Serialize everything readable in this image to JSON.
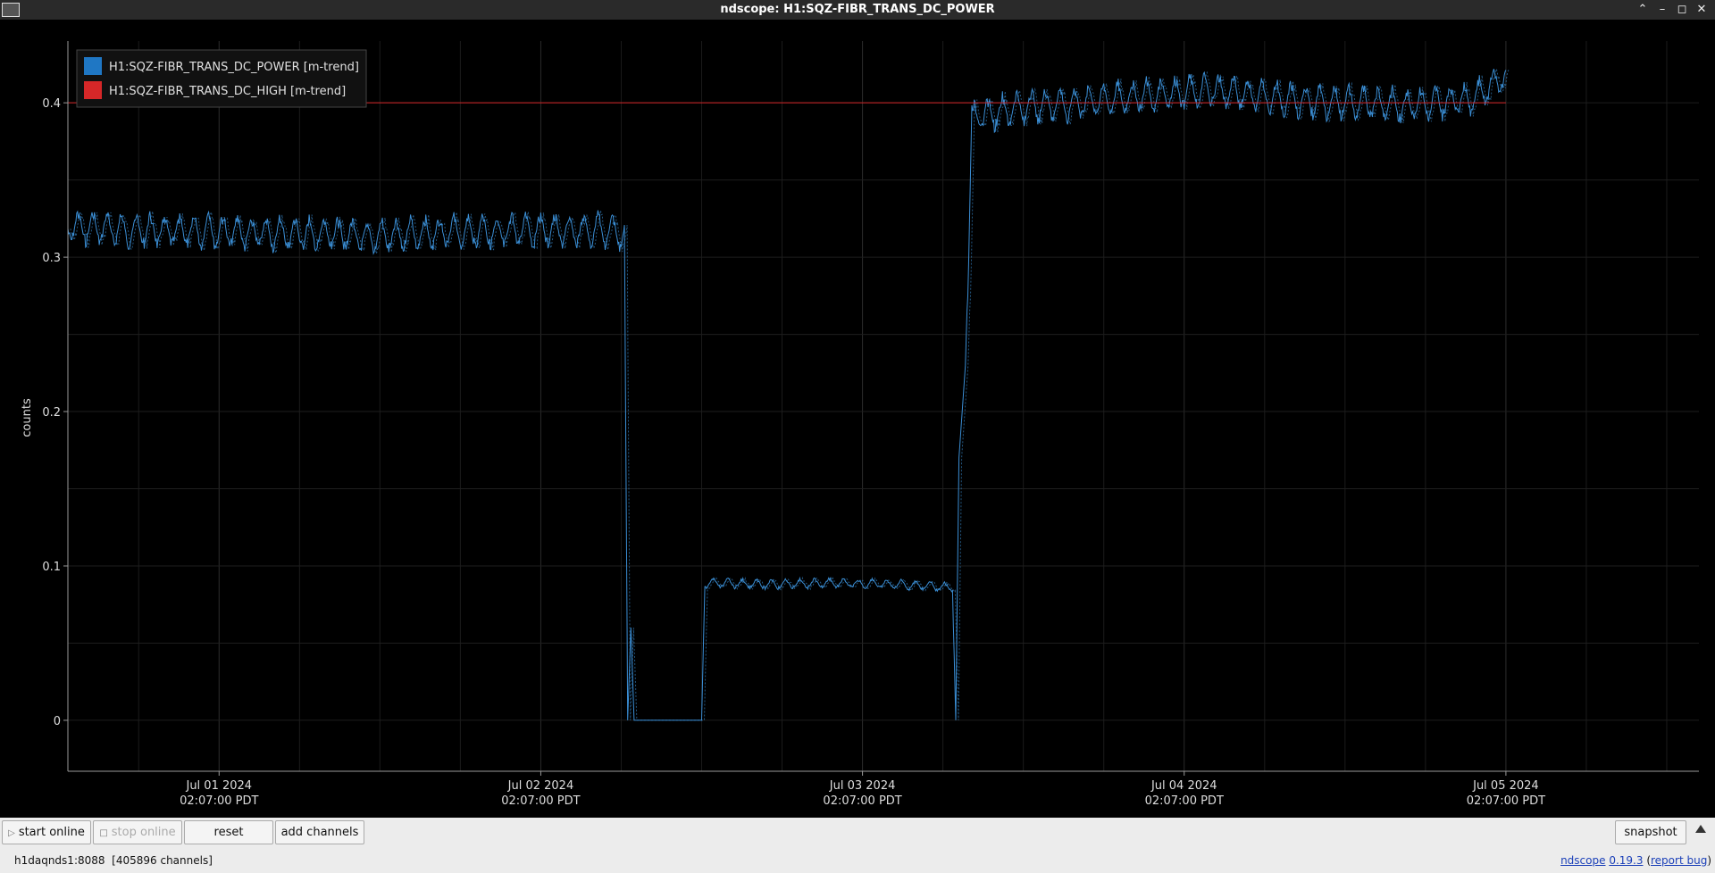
{
  "window": {
    "title": "ndscope: H1:SQZ-FIBR_TRANS_DC_POWER"
  },
  "legend": [
    {
      "label": "H1:SQZ-FIBR_TRANS_DC_POWER [m-trend]",
      "color": "#1f77c4"
    },
    {
      "label": "H1:SQZ-FIBR_TRANS_DC_HIGH [m-trend]",
      "color": "#d62728"
    }
  ],
  "chart_data": {
    "type": "line",
    "ylabel": "counts",
    "ylim": [
      -0.033,
      0.44
    ],
    "yticks": [
      0,
      0.1,
      0.2,
      0.3,
      0.4
    ],
    "ytick_labels": [
      "0",
      "0.1",
      "0.2",
      "0.3",
      "0.4"
    ],
    "xlim_days": [
      -0.47,
      4.6
    ],
    "xticks": [
      {
        "day": 0,
        "date": "Jul 01 2024",
        "time": "02:07:00 PDT"
      },
      {
        "day": 1,
        "date": "Jul 02 2024",
        "time": "02:07:00 PDT"
      },
      {
        "day": 2,
        "date": "Jul 03 2024",
        "time": "02:07:00 PDT"
      },
      {
        "day": 3,
        "date": "Jul 04 2024",
        "time": "02:07:00 PDT"
      },
      {
        "day": 4,
        "date": "Jul 05 2024",
        "time": "02:07:00 PDT"
      }
    ],
    "series": [
      {
        "name": "H1:SQZ-FIBR_TRANS_DC_POWER [m-trend]",
        "color": "#3b8fd6",
        "points": [
          [
            -0.47,
            0.32
          ],
          [
            -0.3,
            0.318
          ],
          [
            -0.1,
            0.317
          ],
          [
            0.1,
            0.316
          ],
          [
            0.3,
            0.315
          ],
          [
            0.5,
            0.314
          ],
          [
            0.7,
            0.316
          ],
          [
            0.9,
            0.317
          ],
          [
            1.1,
            0.318
          ],
          [
            1.2,
            0.317
          ],
          [
            1.26,
            0.315
          ],
          [
            1.27,
            0.0
          ],
          [
            1.28,
            0.06
          ],
          [
            1.29,
            0.0
          ],
          [
            1.5,
            0.0
          ],
          [
            1.51,
            0.089
          ],
          [
            1.7,
            0.088
          ],
          [
            1.9,
            0.089
          ],
          [
            2.1,
            0.088
          ],
          [
            2.28,
            0.086
          ],
          [
            2.29,
            0.0
          ],
          [
            2.3,
            0.17
          ],
          [
            2.32,
            0.23
          ],
          [
            2.33,
            0.3
          ],
          [
            2.34,
            0.39
          ],
          [
            2.5,
            0.398
          ],
          [
            2.7,
            0.4
          ],
          [
            2.9,
            0.405
          ],
          [
            3.1,
            0.408
          ],
          [
            3.3,
            0.403
          ],
          [
            3.5,
            0.4
          ],
          [
            3.7,
            0.398
          ],
          [
            3.9,
            0.403
          ],
          [
            4.0,
            0.418
          ]
        ]
      },
      {
        "name": "H1:SQZ-FIBR_TRANS_DC_HIGH [m-trend]",
        "color": "#d62728",
        "points": [
          [
            -0.47,
            0.4
          ],
          [
            4.0,
            0.4
          ]
        ]
      }
    ]
  },
  "toolbar": {
    "start_online": "start online",
    "stop_online": "stop online",
    "reset": "reset",
    "add_channels": "add channels",
    "snapshot": "snapshot"
  },
  "status": {
    "server": "h1daqnds1:8088",
    "channels": "[405896 channels]",
    "app_name": "ndscope",
    "version": "0.19.3",
    "report_bug": "report bug"
  }
}
